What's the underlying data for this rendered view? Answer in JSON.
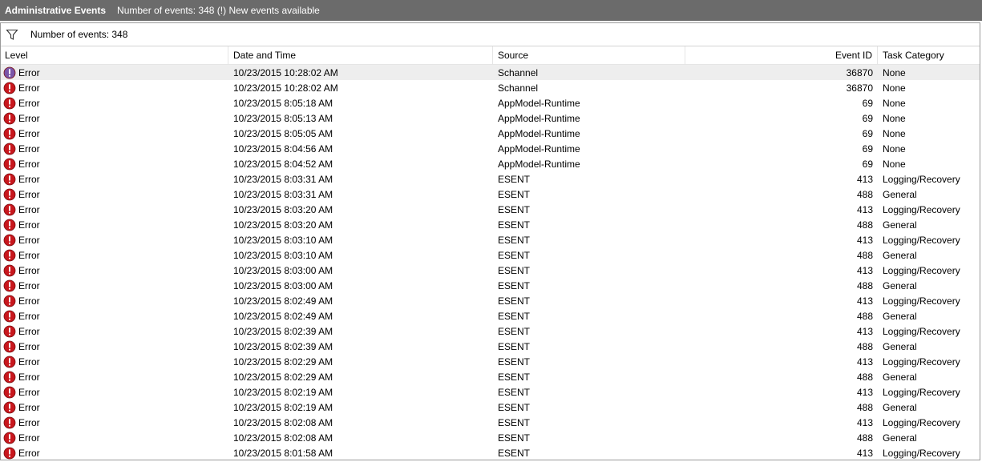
{
  "titlebar": {
    "title": "Administrative Events",
    "status": "Number of events: 348 (!) New events available"
  },
  "filterbar": {
    "icon": "filter-icon",
    "text": "Number of events: 348"
  },
  "columns": {
    "level": "Level",
    "date": "Date and Time",
    "source": "Source",
    "event_id": "Event ID",
    "task": "Task Category"
  },
  "colors": {
    "titlebar_bg": "#6b6b6b",
    "error_red": "#c8171d",
    "selected_icon": "#7a56a8",
    "selected_row": "#eeeeee"
  },
  "rows": [
    {
      "level": "Error",
      "date": "10/23/2015 10:28:02 AM",
      "source": "Schannel",
      "event_id": "36870",
      "task": "None",
      "selected": true
    },
    {
      "level": "Error",
      "date": "10/23/2015 10:28:02 AM",
      "source": "Schannel",
      "event_id": "36870",
      "task": "None"
    },
    {
      "level": "Error",
      "date": "10/23/2015 8:05:18 AM",
      "source": "AppModel-Runtime",
      "event_id": "69",
      "task": "None"
    },
    {
      "level": "Error",
      "date": "10/23/2015 8:05:13 AM",
      "source": "AppModel-Runtime",
      "event_id": "69",
      "task": "None"
    },
    {
      "level": "Error",
      "date": "10/23/2015 8:05:05 AM",
      "source": "AppModel-Runtime",
      "event_id": "69",
      "task": "None"
    },
    {
      "level": "Error",
      "date": "10/23/2015 8:04:56 AM",
      "source": "AppModel-Runtime",
      "event_id": "69",
      "task": "None"
    },
    {
      "level": "Error",
      "date": "10/23/2015 8:04:52 AM",
      "source": "AppModel-Runtime",
      "event_id": "69",
      "task": "None"
    },
    {
      "level": "Error",
      "date": "10/23/2015 8:03:31 AM",
      "source": "ESENT",
      "event_id": "413",
      "task": "Logging/Recovery"
    },
    {
      "level": "Error",
      "date": "10/23/2015 8:03:31 AM",
      "source": "ESENT",
      "event_id": "488",
      "task": "General"
    },
    {
      "level": "Error",
      "date": "10/23/2015 8:03:20 AM",
      "source": "ESENT",
      "event_id": "413",
      "task": "Logging/Recovery"
    },
    {
      "level": "Error",
      "date": "10/23/2015 8:03:20 AM",
      "source": "ESENT",
      "event_id": "488",
      "task": "General"
    },
    {
      "level": "Error",
      "date": "10/23/2015 8:03:10 AM",
      "source": "ESENT",
      "event_id": "413",
      "task": "Logging/Recovery"
    },
    {
      "level": "Error",
      "date": "10/23/2015 8:03:10 AM",
      "source": "ESENT",
      "event_id": "488",
      "task": "General"
    },
    {
      "level": "Error",
      "date": "10/23/2015 8:03:00 AM",
      "source": "ESENT",
      "event_id": "413",
      "task": "Logging/Recovery"
    },
    {
      "level": "Error",
      "date": "10/23/2015 8:03:00 AM",
      "source": "ESENT",
      "event_id": "488",
      "task": "General"
    },
    {
      "level": "Error",
      "date": "10/23/2015 8:02:49 AM",
      "source": "ESENT",
      "event_id": "413",
      "task": "Logging/Recovery"
    },
    {
      "level": "Error",
      "date": "10/23/2015 8:02:49 AM",
      "source": "ESENT",
      "event_id": "488",
      "task": "General"
    },
    {
      "level": "Error",
      "date": "10/23/2015 8:02:39 AM",
      "source": "ESENT",
      "event_id": "413",
      "task": "Logging/Recovery"
    },
    {
      "level": "Error",
      "date": "10/23/2015 8:02:39 AM",
      "source": "ESENT",
      "event_id": "488",
      "task": "General"
    },
    {
      "level": "Error",
      "date": "10/23/2015 8:02:29 AM",
      "source": "ESENT",
      "event_id": "413",
      "task": "Logging/Recovery"
    },
    {
      "level": "Error",
      "date": "10/23/2015 8:02:29 AM",
      "source": "ESENT",
      "event_id": "488",
      "task": "General"
    },
    {
      "level": "Error",
      "date": "10/23/2015 8:02:19 AM",
      "source": "ESENT",
      "event_id": "413",
      "task": "Logging/Recovery"
    },
    {
      "level": "Error",
      "date": "10/23/2015 8:02:19 AM",
      "source": "ESENT",
      "event_id": "488",
      "task": "General"
    },
    {
      "level": "Error",
      "date": "10/23/2015 8:02:08 AM",
      "source": "ESENT",
      "event_id": "413",
      "task": "Logging/Recovery"
    },
    {
      "level": "Error",
      "date": "10/23/2015 8:02:08 AM",
      "source": "ESENT",
      "event_id": "488",
      "task": "General"
    },
    {
      "level": "Error",
      "date": "10/23/2015 8:01:58 AM",
      "source": "ESENT",
      "event_id": "413",
      "task": "Logging/Recovery"
    }
  ]
}
